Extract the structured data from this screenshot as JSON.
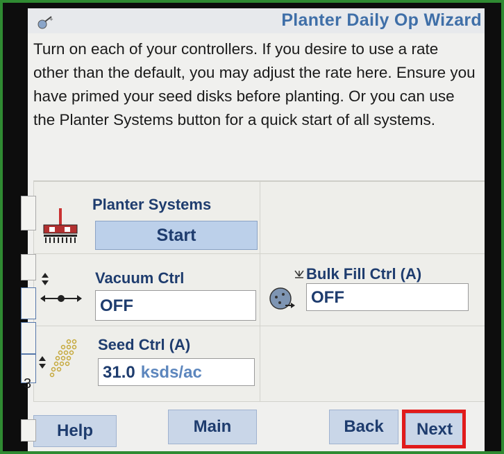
{
  "window": {
    "title": "Planter Daily Op Wizard"
  },
  "instructions": "Turn on each of your controllers. If you desire to use a rate other than the default, you may adjust the rate here. Ensure you have primed your seed disks before planting. Or you can use the Planter Systems button for a quick start of all systems.",
  "controllers": {
    "planter_systems": {
      "label": "Planter Systems",
      "button": "Start"
    },
    "vacuum": {
      "label": "Vacuum Ctrl",
      "value": "OFF"
    },
    "bulk_fill": {
      "label": "Bulk Fill Ctrl (A)",
      "value": "OFF"
    },
    "seed": {
      "label": "Seed Ctrl (A)",
      "value": "31.0",
      "unit": "ksds/ac"
    }
  },
  "edge_text": "3",
  "buttons": {
    "help": "Help",
    "main": "Main",
    "back": "Back",
    "next": "Next"
  },
  "colors": {
    "frame": "#2f8a32",
    "title": "#3f6fa8",
    "label": "#1e3c6e",
    "button": "#c9d6e8",
    "highlight": "#e11b1b"
  },
  "icons": {
    "wizard": "wizard-wand-icon",
    "planter": "planter-icon",
    "vacuum": "vacuum-flow-icon",
    "bulk_fill": "bulk-fill-icon",
    "seed": "seed-icon"
  }
}
